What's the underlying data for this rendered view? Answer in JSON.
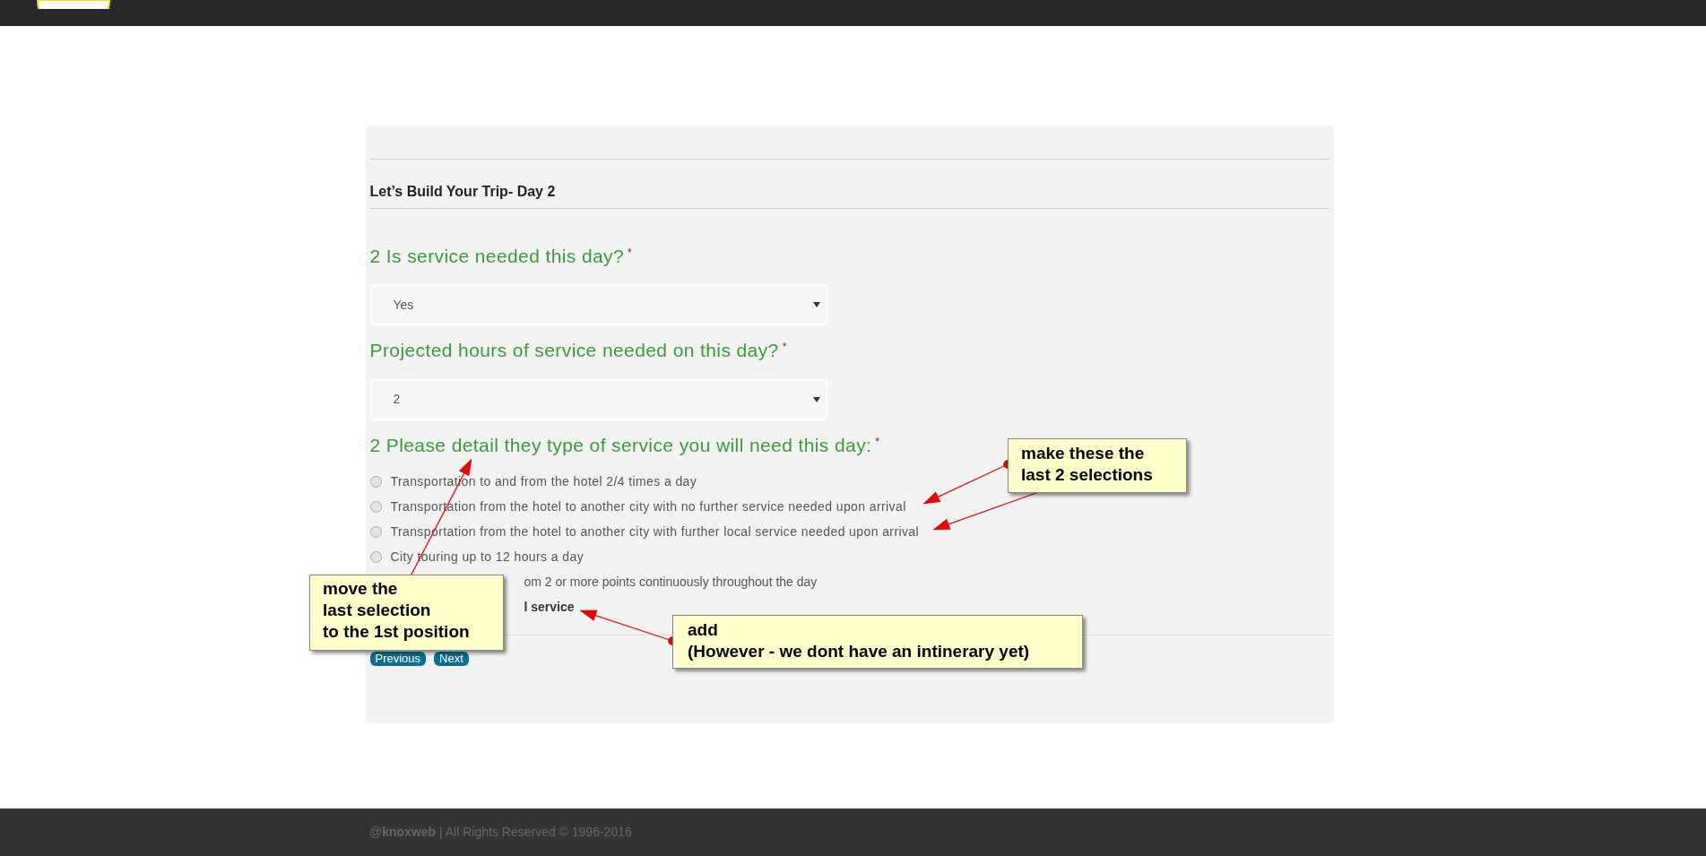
{
  "form": {
    "title": "Let’s Build Your Trip- Day 2",
    "questions": [
      {
        "kind": "select",
        "label": "2 Is service needed this day?",
        "required_mark": "*",
        "value": "Yes"
      },
      {
        "kind": "select",
        "label": "Projected hours of service needed on this day?",
        "required_mark": "*",
        "value": "2"
      },
      {
        "kind": "radios",
        "label": "2 Please detail they type of service you will need this day:",
        "required_mark": "*",
        "options": [
          {
            "kind": "radio",
            "label": "Transportation to and from the hotel 2/4 times a day",
            "selected": false
          },
          {
            "kind": "radio",
            "label": "Transportation from the hotel to another city with no further service needed upon arrival",
            "selected": false
          },
          {
            "kind": "radio",
            "label": "Transportation from the hotel to another city with further local service needed upon arrival",
            "selected": false
          },
          {
            "kind": "radio",
            "label": "City touring up to 12 hours a day",
            "selected": false
          },
          {
            "kind": "partial",
            "label": "om 2 or more points continuously throughout the day",
            "bold": false
          },
          {
            "kind": "partial",
            "label": "l service",
            "bold": true
          }
        ]
      }
    ],
    "buttons": [
      "Previous",
      "Next"
    ]
  },
  "annotations": [
    {
      "text": "make these the\nlast 2 selections"
    },
    {
      "text": "move the\nlast selection\nto the 1st position"
    },
    {
      "text": "add\n(However - we dont have an intinerary yet)"
    }
  ],
  "footer": {
    "text": "@**knoxweb** | All Rights Reserved © 1996-2016"
  }
}
